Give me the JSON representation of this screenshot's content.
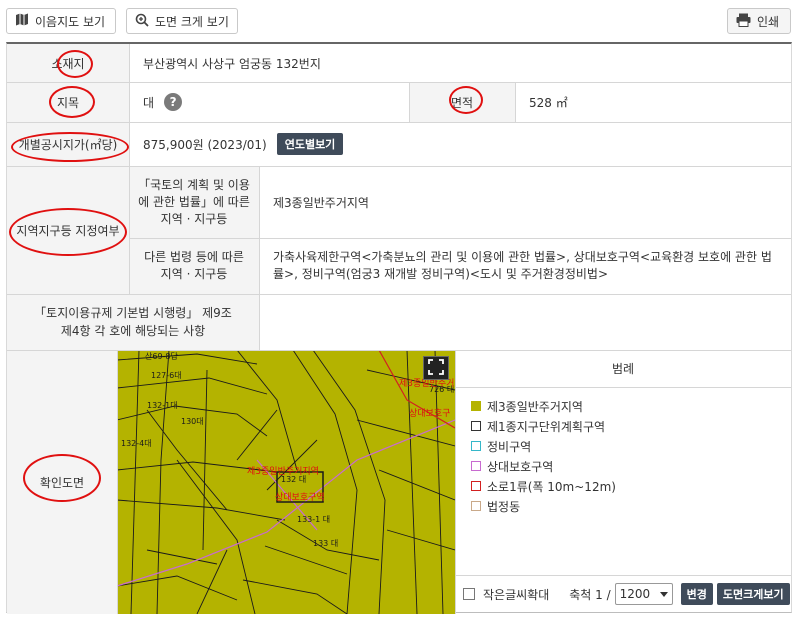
{
  "toolbar": {
    "map_label": "이음지도 보기",
    "enlarge_label": "도면 크게 보기",
    "print_label": "인쇄"
  },
  "rows": {
    "location": {
      "label": "소재지",
      "value": "부산광역시 사상구 엄궁동 132번지"
    },
    "jimok": {
      "label": "지목",
      "value": "대",
      "help": "?"
    },
    "area": {
      "label": "면적",
      "value": "528 ㎡"
    },
    "price": {
      "label": "개별공시지가(㎡당)",
      "value": "875,900원 (2023/01)",
      "button": "연도별보기"
    },
    "zoning": {
      "label": "지역지구등 지정여부",
      "law1_label": "「국토의 계획 및 이용에 관한 법률」에 따른 지역 · 지구등",
      "law1_value": "제3종일반주거지역",
      "law2_label": "다른 법령 등에 따른 지역 · 지구등",
      "law2_value": "가축사육제한구역<가축분뇨의 관리 및 이용에 관한 법률>, 상대보호구역<교육환경 보호에 관한 법률>, 정비구역(엄궁3 재개발 정비구역)<도시 및 주거환경정비법>"
    },
    "regulation": {
      "label": "「토지이용규제 기본법 시행령」 제9조 제4항 각 호에 해당되는 사항",
      "value": ""
    },
    "map": {
      "label": "확인도면"
    }
  },
  "map_labels": {
    "p1": "산69-8답",
    "p2": "127-6대",
    "p3": "132-1대",
    "p4": "130대",
    "p5": "132-4대",
    "p6": "132 대",
    "p7": "133-1 대",
    "p8": "133 대",
    "p9": "726 대",
    "zone_red": "제3종일반주거지역",
    "zone_red2": "상대보호구역",
    "top_red": "제3종일반주거",
    "top_red2": "상대보호구"
  },
  "legend": {
    "title": "범례",
    "items": [
      {
        "label": "제3종일반주거지역",
        "color": "#b4b300",
        "filled": true
      },
      {
        "label": "제1종지구단위계획구역",
        "color": "#333333",
        "filled": false
      },
      {
        "label": "정비구역",
        "color": "#36b7c9",
        "filled": false
      },
      {
        "label": "상대보호구역",
        "color": "#c86bd0",
        "filled": false
      },
      {
        "label": "소로1류(폭 10m~12m)",
        "color": "#d22020",
        "filled": false
      },
      {
        "label": "법정동",
        "color": "#c9a98a",
        "filled": false
      }
    ]
  },
  "controls": {
    "small_text_label": "작은글씨확대",
    "scale_label": "축척 1 /",
    "scale_value": "1200",
    "change_label": "변경",
    "enlarge_label": "도면크게보기"
  }
}
